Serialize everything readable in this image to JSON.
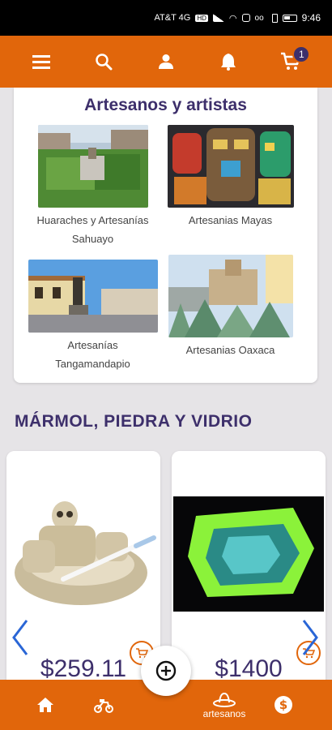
{
  "status_bar": {
    "carrier": "AT&T 4G",
    "net_badge": "HD",
    "time": "9:46"
  },
  "header": {
    "cart_count": "1"
  },
  "artisans": {
    "title": "Artesanos y artistas",
    "items": [
      {
        "line1": "Huaraches y Artesanías",
        "line2": "Sahuayo"
      },
      {
        "line1": "Artesanias Mayas",
        "line2": ""
      },
      {
        "line1": "Artesanías",
        "line2": "Tangamandapio"
      },
      {
        "line1": "Artesanias Oaxaca",
        "line2": ""
      }
    ]
  },
  "section": {
    "title": "MÁRMOL, PIEDRA Y VIDRIO"
  },
  "products": [
    {
      "price": "$259.11"
    },
    {
      "price": "$1400"
    }
  ],
  "bottom_nav": {
    "artesanos_label": "artesanos"
  },
  "colors": {
    "brand_orange": "#e1660b",
    "brand_purple": "#3d2f6b",
    "arrow_blue": "#2a66d6"
  }
}
